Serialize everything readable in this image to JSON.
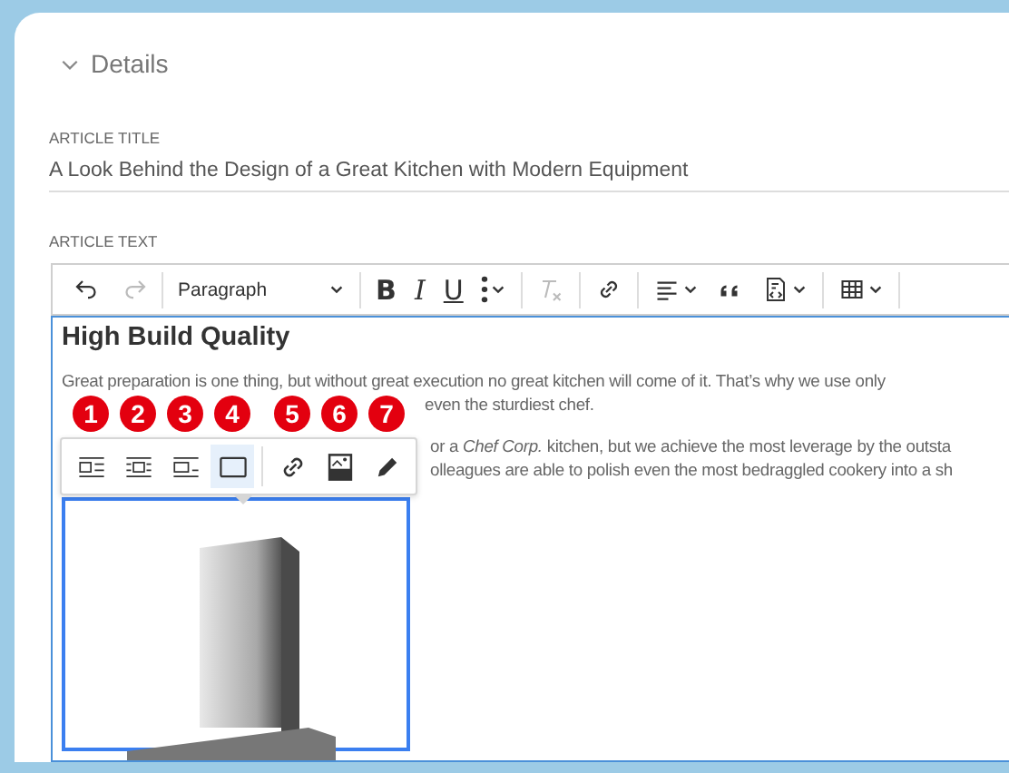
{
  "section": {
    "title": "Details",
    "expanded": true
  },
  "article_title": {
    "label": "ARTICLE TITLE",
    "value": "A Look Behind the Design of a Great Kitchen with Modern Equipment"
  },
  "article_text": {
    "label": "ARTICLE TEXT",
    "toolbar": [
      [
        {
          "kind": "undo",
          "disabled": false
        },
        {
          "kind": "redo",
          "disabled": true
        }
      ],
      [
        {
          "kind": "heading",
          "label": "Paragraph",
          "disabled": false
        }
      ],
      [
        {
          "kind": "bold",
          "label": "B",
          "disabled": false
        },
        {
          "kind": "italic",
          "label": "I",
          "disabled": false
        },
        {
          "kind": "underline",
          "label": "U",
          "disabled": false
        },
        {
          "kind": "more",
          "disabled": false
        }
      ],
      [
        {
          "kind": "clear-format",
          "disabled": true
        }
      ],
      [
        {
          "kind": "link",
          "disabled": false
        }
      ],
      [
        {
          "kind": "align",
          "disabled": false
        },
        {
          "kind": "quote",
          "disabled": false
        },
        {
          "kind": "code-block",
          "disabled": false
        }
      ],
      [
        {
          "kind": "table",
          "disabled": false
        }
      ]
    ],
    "heading": "High Build Quality",
    "paragraph_1": [
      "Great preparation is one thing, but without great execution no great kitchen will come of it. That’s why we use only",
      "even the sturdiest chef."
    ],
    "paragraph_2": [
      "or a *Chef Corp.* kitchen, but we achieve the most leverage by the outsta",
      "olleagues are able to polish even the most bedraggled cookery into a sh"
    ],
    "image_toolbar": [
      {
        "kind": "align-left",
        "badge": "1",
        "selected": false
      },
      {
        "kind": "align-center",
        "badge": "2",
        "selected": false
      },
      {
        "kind": "align-right",
        "badge": "3",
        "selected": false
      },
      {
        "kind": "full",
        "badge": "4",
        "selected": true
      },
      {
        "kind": "link",
        "badge": "5",
        "selected": false
      },
      {
        "kind": "alt",
        "badge": "6",
        "selected": false
      },
      {
        "kind": "edit",
        "badge": "7",
        "selected": false
      }
    ]
  }
}
